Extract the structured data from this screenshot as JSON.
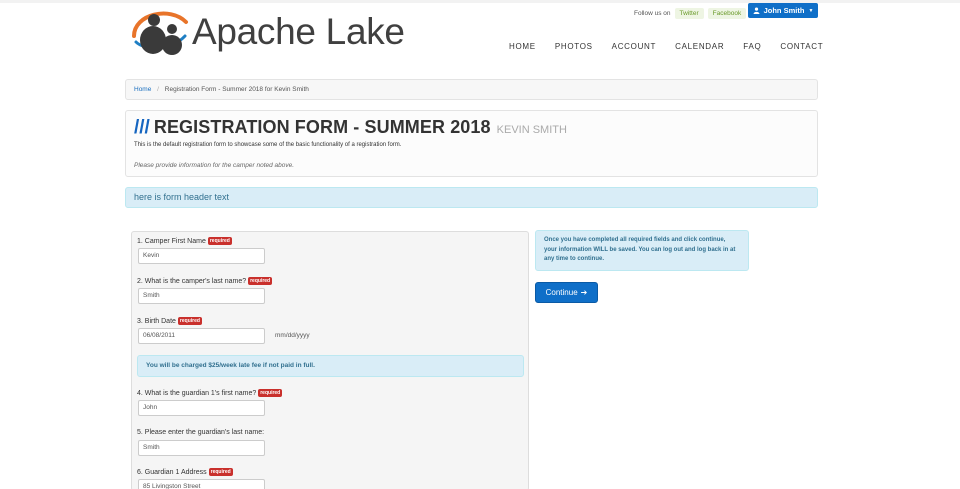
{
  "brand": {
    "name": "Apache Lake"
  },
  "header": {
    "follow_label": "Follow us on",
    "twitter_label": "Twitter",
    "facebook_label": "Facebook",
    "user_label": "John Smith",
    "nav": [
      {
        "label": "HOME"
      },
      {
        "label": "PHOTOS"
      },
      {
        "label": "ACCOUNT"
      },
      {
        "label": "CALENDAR"
      },
      {
        "label": "FAQ"
      },
      {
        "label": "CONTACT"
      }
    ]
  },
  "breadcrumb": {
    "home": "Home",
    "separator": "/",
    "current": "Registration Form - Summer 2018 for Kevin Smith"
  },
  "page": {
    "slashes": "///",
    "title": "REGISTRATION FORM - SUMMER 2018",
    "subtitle": "KEVIN SMITH",
    "description": "This is the default registration form to showcase some of the basic functionality of a registration form.",
    "note": "Please provide information for the camper noted above."
  },
  "form_header": "here is form header text",
  "form": {
    "required_label": "required",
    "fields": [
      {
        "label": "1. Camper First Name",
        "required": true,
        "value": "Kevin"
      },
      {
        "label": "2. What is the camper's last name?",
        "required": true,
        "value": "Smith"
      },
      {
        "label": "3. Birth Date",
        "required": true,
        "value": "06/08/2011",
        "hint": "mm/dd/yyyy"
      },
      {
        "label": "4. What is the guardian 1's first name?",
        "required": true,
        "value": "John"
      },
      {
        "label": "5. Please enter the guardian's last name:",
        "required": false,
        "value": "Smith"
      },
      {
        "label": "6. Guardian 1 Address",
        "required": true,
        "value": "85 Livingston Street"
      }
    ],
    "fee_alert": "You will be charged $25/week late fee if not paid in full."
  },
  "sidebar": {
    "note": "Once you have completed all required fields and click continue, your information WILL be saved. You can log out and log back in at any time to continue.",
    "continue_label": "Continue"
  },
  "colors": {
    "accent": "#0f6fc8",
    "title_accent": "#1565c0",
    "required_badge": "#c9302c",
    "info_background": "#d9edf7",
    "info_text": "#31708f"
  }
}
